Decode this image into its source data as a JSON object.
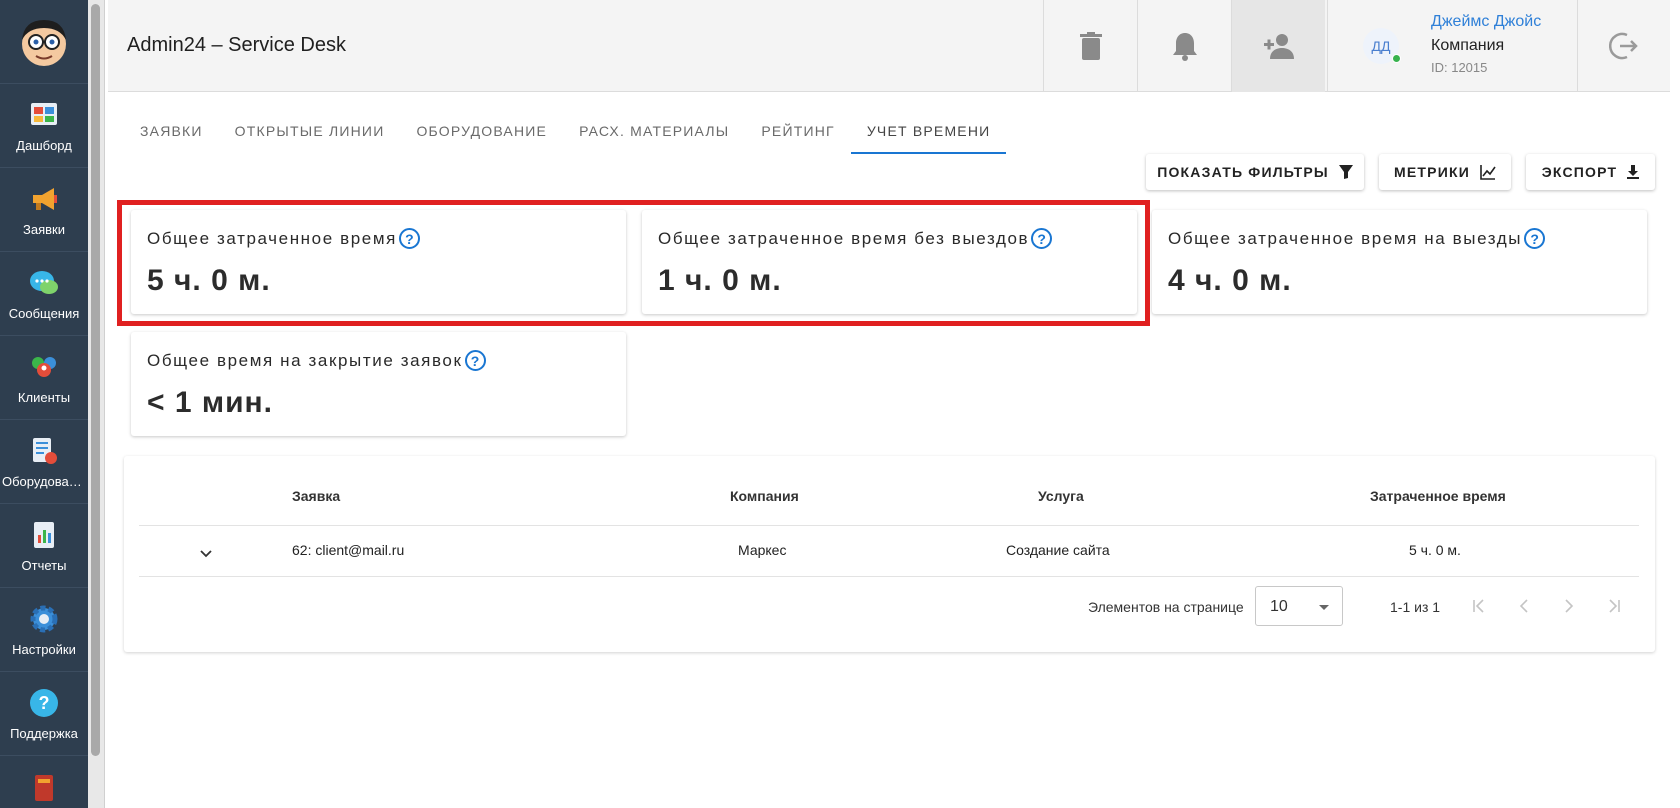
{
  "sidebar": {
    "items": [
      {
        "label": "Дашборд",
        "icon": "dashboard-icon"
      },
      {
        "label": "Заявки",
        "icon": "megaphone-icon"
      },
      {
        "label": "Сообщения",
        "icon": "chat-icon"
      },
      {
        "label": "Клиенты",
        "icon": "clients-icon"
      },
      {
        "label": "Оборудован…",
        "icon": "equipment-icon"
      },
      {
        "label": "Отчеты",
        "icon": "reports-icon"
      },
      {
        "label": "Настройки",
        "icon": "gear-icon"
      },
      {
        "label": "Поддержка",
        "icon": "help-icon"
      }
    ]
  },
  "header": {
    "title": "Admin24 – Service Desk",
    "user": {
      "initials": "ДД",
      "name": "Джеймс Джойс",
      "company": "Компания",
      "id": "ID: 12015"
    }
  },
  "tabs": [
    {
      "label": "ЗАЯВКИ"
    },
    {
      "label": "ОТКРЫТЫЕ ЛИНИИ"
    },
    {
      "label": "ОБОРУДОВАНИЕ"
    },
    {
      "label": "РАСХ. МАТЕРИАЛЫ"
    },
    {
      "label": "РЕЙТИНГ"
    },
    {
      "label": "УЧЕТ ВРЕМЕНИ"
    }
  ],
  "active_tab": "УЧЕТ ВРЕМЕНИ",
  "actions": {
    "filters": "ПОКАЗАТЬ ФИЛЬТРЫ",
    "metrics": "МЕТРИКИ",
    "export": "ЭКСПОРТ"
  },
  "stats": [
    {
      "title": "Общее затраченное время",
      "value": "5 ч. 0 м."
    },
    {
      "title": "Общее затраченное время без выездов",
      "value": "1 ч. 0 м."
    },
    {
      "title": "Общее затраченное время на выезды",
      "value": "4 ч. 0 м."
    },
    {
      "title": "Общее время на закрытие заявок",
      "value": "< 1 мин."
    }
  ],
  "help_glyph": "?",
  "table": {
    "headers": {
      "ticket": "Заявка",
      "company": "Компания",
      "service": "Услуга",
      "time": "Затраченное время"
    },
    "rows": [
      {
        "ticket": "62: client@mail.ru",
        "company": "Маркес",
        "service": "Создание сайта",
        "time": "5 ч. 0 м."
      }
    ],
    "pagination": {
      "per_page_label": "Элементов на странице",
      "per_page": "10",
      "range": "1-1 из 1"
    }
  },
  "colors": {
    "sidebar_bg": "#2e3e4f",
    "accent": "#1976d2",
    "highlight": "#e02020",
    "online": "#37b24d"
  }
}
